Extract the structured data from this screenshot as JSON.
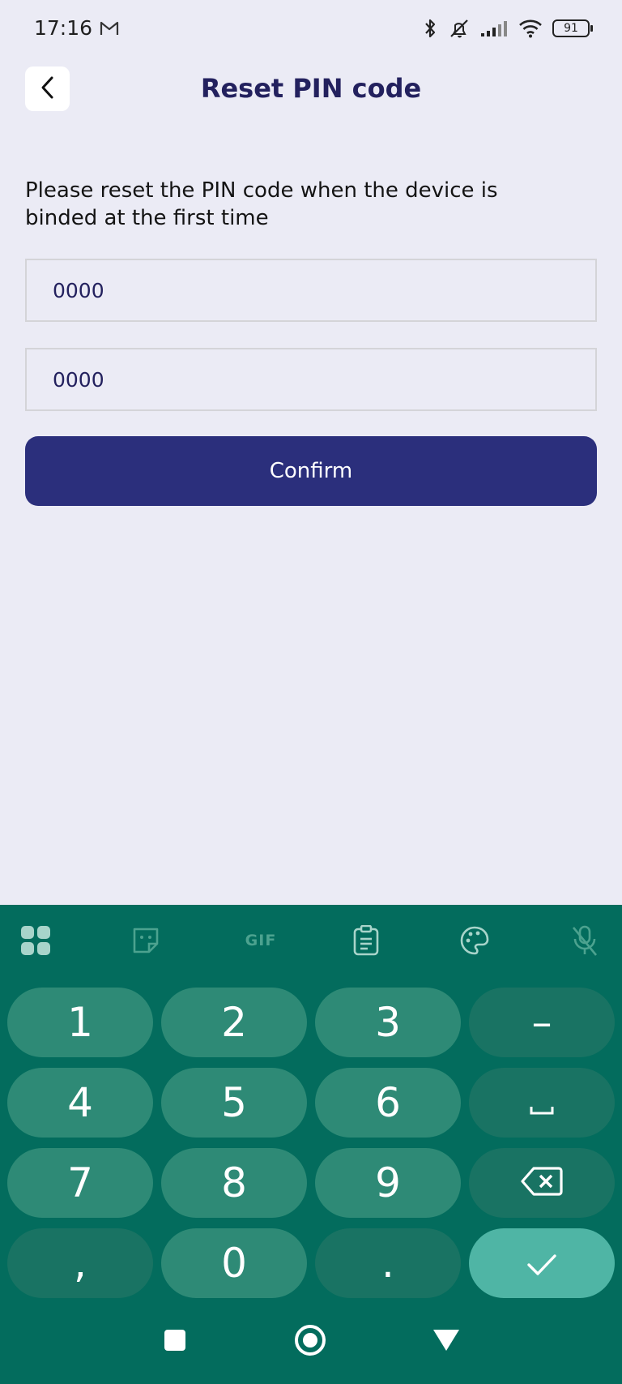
{
  "status_bar": {
    "time": "17:16",
    "battery": "91",
    "icons": [
      "gmail-icon",
      "bluetooth-icon",
      "silent-icon",
      "signal-icon",
      "wifi-icon",
      "battery-icon"
    ]
  },
  "header": {
    "title": "Reset PIN code",
    "back_icon": "chevron-left-icon"
  },
  "instruction": "Please reset the PIN code when the device is binded at the first time",
  "fields": {
    "pin": "0000",
    "pin_confirm": "0000"
  },
  "confirm_label": "Confirm",
  "keyboard": {
    "toolbar": {
      "gif_label": "GIF",
      "icons": [
        "apps-grid-icon",
        "sticker-icon",
        "gif-icon",
        "clipboard-icon",
        "palette-icon",
        "mic-off-icon"
      ]
    },
    "keys": {
      "k1": "1",
      "k2": "2",
      "k3": "3",
      "minus": "–",
      "k4": "4",
      "k5": "5",
      "k6": "6",
      "space_icon": "space-icon",
      "k7": "7",
      "k8": "8",
      "k9": "9",
      "backspace_icon": "backspace-icon",
      "comma": ",",
      "k0": "0",
      "period": ".",
      "enter_icon": "checkmark-icon"
    }
  },
  "nav_bar": {
    "icons": [
      "recent-apps-icon",
      "home-icon",
      "back-icon"
    ]
  },
  "colors": {
    "background": "#ebebf5",
    "title": "#23215e",
    "confirm": "#2b2f7c",
    "keyboard": "#036c5d",
    "key": "#2e8a76",
    "enter_key": "#4fb5a5"
  }
}
